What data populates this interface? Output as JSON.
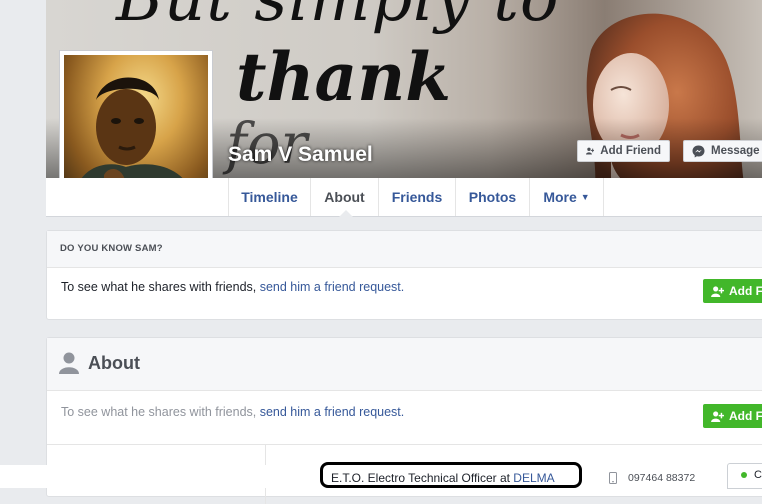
{
  "profile": {
    "name": "Sam V Samuel",
    "cover_text": [
      "But simply to",
      "thank",
      "for"
    ]
  },
  "cover_actions": {
    "add_friend": "Add Friend",
    "message": "Message"
  },
  "nav": {
    "tabs": [
      {
        "label": "Timeline"
      },
      {
        "label": "About"
      },
      {
        "label": "Friends"
      },
      {
        "label": "Photos"
      },
      {
        "label": "More"
      }
    ],
    "active_tab": "About"
  },
  "know_card": {
    "title": "DO YOU KNOW SAM?",
    "prefix": "To see what he shares with friends, ",
    "link": "send him a friend request.",
    "button": "Add F"
  },
  "about_card": {
    "title": "About",
    "prefix": "To see what he shares with friends, ",
    "link": "send him a friend request.",
    "button": "Add F"
  },
  "details": {
    "job_prefix": "E.T.O. Electro Technical Officer at ",
    "job_company": "DELMA",
    "phone": "097464 88372",
    "chat_label": "C"
  },
  "colors": {
    "link": "#365899",
    "green": "#42b72a",
    "background": "#e9ebee"
  }
}
